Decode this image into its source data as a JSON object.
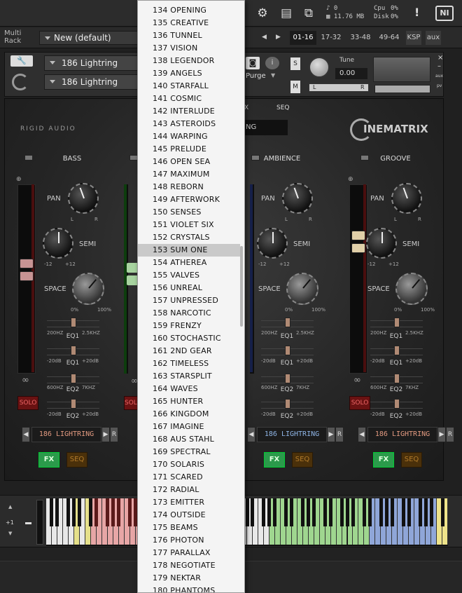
{
  "topbar": {
    "cpu_label": "Cpu",
    "cpu_value": "0%",
    "disk_label": "Disk",
    "disk_value": "0%",
    "voices": "0",
    "memory": "11.76 MB",
    "warning": "!",
    "ni_logo": "NI"
  },
  "rack": {
    "label_line1": "Multi",
    "label_line2": "Rack",
    "preset": "New (default)",
    "pages": [
      "01-16",
      "17-32",
      "33-48",
      "49-64"
    ],
    "ksp": "KSP",
    "aux": "aux"
  },
  "instrument": {
    "name1": "186 Lightring",
    "name2": "186 Lightring",
    "purge": "Purge",
    "tune_label": "Tune",
    "tune_value": "0.00",
    "s": "S",
    "m": "M",
    "l": "L",
    "r": "R",
    "aux": "aux",
    "pv": "pv"
  },
  "panel": {
    "rigid_audio": "RIGID AUDIO",
    "cinematrix": "INEMATRIX",
    "tab_fx": "X",
    "tab_seq": "SEQ",
    "tab_field": "NG",
    "channels": [
      {
        "title": "BASS",
        "pan": "PAN",
        "semi": "SEMI",
        "space": "SPACE",
        "l": "L",
        "r": "R",
        "neg12": "-12",
        "pos12": "+12",
        "pct0": "0%",
        "pct100": "100%",
        "eq1_low": "200HZ",
        "eq1_high": "2.5KHZ",
        "eq1": "EQ1",
        "db_low": "-20dB",
        "db_high": "+20dB",
        "eq2_low": "600HZ",
        "eq2_high": "7KHZ",
        "eq2": "EQ2",
        "solo": "SOLO",
        "preset": "186 LIGHTRING",
        "fx": "FX",
        "seq": "SEQ",
        "fader_color": "#c79393"
      },
      {
        "title": "AMBIENCE",
        "pan": "PAN",
        "semi": "SEMI",
        "space": "SPACE",
        "l": "L",
        "r": "R",
        "neg12": "-12",
        "pos12": "+12",
        "pct0": "0%",
        "pct100": "100%",
        "eq1_low": "200HZ",
        "eq1_high": "2.5KHZ",
        "eq1": "EQ1",
        "db_low": "-20dB",
        "db_high": "+20dB",
        "eq2_low": "600HZ",
        "eq2_high": "7KHZ",
        "eq2": "EQ2",
        "solo": "SOLO",
        "preset": "186 LIGHTRING",
        "fx": "FX",
        "seq": "SEQ",
        "fader_color": "#6f86c2"
      },
      {
        "title": "GROOVE",
        "pan": "PAN",
        "semi": "SEMI",
        "space": "SPACE",
        "l": "L",
        "r": "R",
        "neg12": "-12",
        "pos12": "+12",
        "pct0": "0%",
        "pct100": "100%",
        "eq1_low": "200HZ",
        "eq1_high": "2.5KHZ",
        "eq1": "EQ1",
        "db_low": "-20dB",
        "db_high": "+20dB",
        "eq2_low": "600HZ",
        "eq2_high": "7KHZ",
        "eq2": "EQ2",
        "solo": "SOLO",
        "preset": "186 LIGHTRING",
        "fx": "FX",
        "seq": "SEQ",
        "fader_color": "#e0cfa8"
      }
    ],
    "partial_solo": "SOLO"
  },
  "keyboard": {
    "octave": "+1"
  },
  "dropdown": {
    "highlighted": "153 SUM ONE",
    "items": [
      "134 OPENING",
      "135 CREATIVE",
      "136 TUNNEL",
      "137 VISION",
      "138 LEGENDOR",
      "139 ANGELS",
      "140 STARFALL",
      "141 COSMIC",
      "142 INTERLUDE",
      "143 ASTEROIDS",
      "144 WARPING",
      "145 PRELUDE",
      "146 OPEN SEA",
      "147 MAXIMUM",
      "148 REBORN",
      "149 AFTERWORK",
      "150 SENSES",
      "151 VIOLET SIX",
      "152 CRYSTALS",
      "153 SUM ONE",
      "154 ATHEREA",
      "155 VALVES",
      "156 UNREAL",
      "157 UNPRESSED",
      "158 NARCOTIC",
      "159 FRENZY",
      "160 STOCHASTIC",
      "161 2ND GEAR",
      "162 TIMELESS",
      "163 STARSPLIT",
      "164 WAVES",
      "165 HUNTER",
      "166 KINGDOM",
      "167 IMAGINE",
      "168 AUS STAHL",
      "169 SPECTRAL",
      "170 SOLARIS",
      "171 SCARED",
      "172 RADIAL",
      "173 EMITTER",
      "174 OUTSIDE",
      "175 BEAMS",
      "176 PHOTON",
      "177 PARALLAX",
      "178 NEGOTIATE",
      "179 NEKTAR",
      "180 PHANTOMS"
    ]
  }
}
